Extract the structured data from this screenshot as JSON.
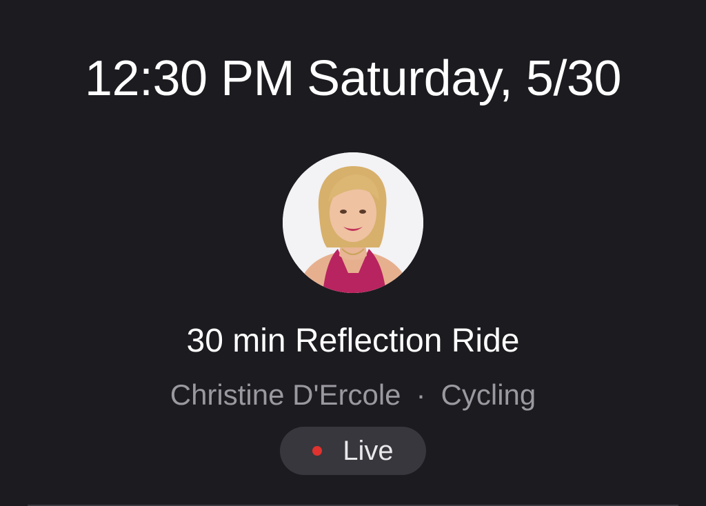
{
  "header": {
    "time": "12:30 PM",
    "day_date": "Saturday, 5/30"
  },
  "class": {
    "title": "30 min Reflection Ride",
    "instructor": "Christine D'Ercole",
    "separator": "·",
    "discipline": "Cycling",
    "status_label": "Live",
    "status_color": "#e0322e"
  },
  "colors": {
    "background": "#1c1b20",
    "primary_text": "#ffffff",
    "secondary_text": "#9a999f",
    "pill_background": "#38373d"
  }
}
